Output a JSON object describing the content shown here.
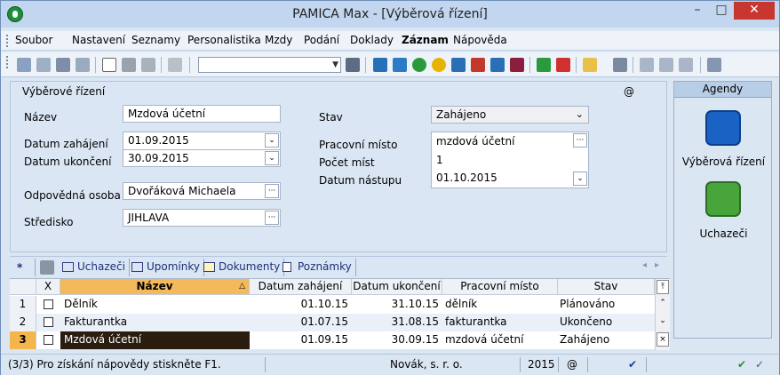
{
  "window": {
    "title": "PAMICA Max - [Výběrová řízení]",
    "minimize": "–",
    "maximize": "□",
    "close": "✕"
  },
  "menu": [
    "Soubor",
    "Nastavení",
    "Seznamy",
    "Personalistika",
    "Mzdy",
    "Podání",
    "Doklady",
    "Záznam",
    "Nápověda"
  ],
  "form": {
    "section_title": "Výběrové řízení",
    "at_symbol": "@",
    "nazev_label": "Název",
    "nazev_value": "Mzdová účetní",
    "datum_zahajeni_label": "Datum zahájení",
    "datum_zahajeni_value": "01.09.2015",
    "datum_ukonceni_label": "Datum ukončení",
    "datum_ukonceni_value": "30.09.2015",
    "odpovedna_osoba_label": "Odpovědná osoba",
    "odpovedna_osoba_value": "Dvořáková Michaela",
    "stredisko_label": "Středisko",
    "stredisko_value": "JIHLAVA",
    "stav_label": "Stav",
    "stav_value": "Zahájeno",
    "pracovni_misto_label": "Pracovní místo",
    "pracovni_misto_value": "mzdová účetní",
    "pocet_mist_label": "Počet míst",
    "pocet_mist_value": "1",
    "datum_nastupu_label": "Datum nástupu",
    "datum_nastupu_value": "01.10.2015",
    "dots": "···",
    "dropdown_glyph": "⌄"
  },
  "agendy": {
    "header": "Agendy",
    "items": [
      {
        "label": "Výběrová řízení",
        "icon": "circle-arrow-icon"
      },
      {
        "label": "Uchazeči",
        "icon": "people-icon"
      }
    ]
  },
  "tabs": {
    "star": "*",
    "items": [
      {
        "label": "Uchazeči"
      },
      {
        "label": "Upomínky"
      },
      {
        "label": "Dokumenty"
      },
      {
        "label": "Poznámky"
      }
    ],
    "nav_left": "◂",
    "nav_right": "▸"
  },
  "grid": {
    "headers": [
      "X",
      "Název",
      "Datum zahájení",
      "Datum ukončení",
      "Pracovní místo",
      "Stav"
    ],
    "sort_glyph": "△",
    "rows": [
      {
        "num": "1",
        "nazev": "Dělník",
        "zahajeni": "01.10.15",
        "ukonceni": "31.10.15",
        "misto": "dělník",
        "stav": "Plánováno"
      },
      {
        "num": "2",
        "nazev": "Fakturantka",
        "zahajeni": "01.07.15",
        "ukonceni": "31.08.15",
        "misto": "fakturantka",
        "stav": "Ukončeno"
      },
      {
        "num": "3",
        "nazev": "Mzdová účetní",
        "zahajeni": "01.09.15",
        "ukonceni": "30.09.15",
        "misto": "mzdová účetní",
        "stav": "Zahájeno"
      }
    ],
    "scroll_top": "⤒",
    "scroll_up": "⌃",
    "scroll_down": "⌄",
    "scroll_bottom": "×"
  },
  "status": {
    "help": "(3/3) Pro získání nápovědy stiskněte F1.",
    "company": "Novák, s. r. o.",
    "year": "2015",
    "at": "@",
    "check": "✔",
    "tool": "✓"
  },
  "colors": {
    "accent_orange": "#f3b95a",
    "selected_row": "#2a1d10",
    "close_red": "#c7372f"
  }
}
